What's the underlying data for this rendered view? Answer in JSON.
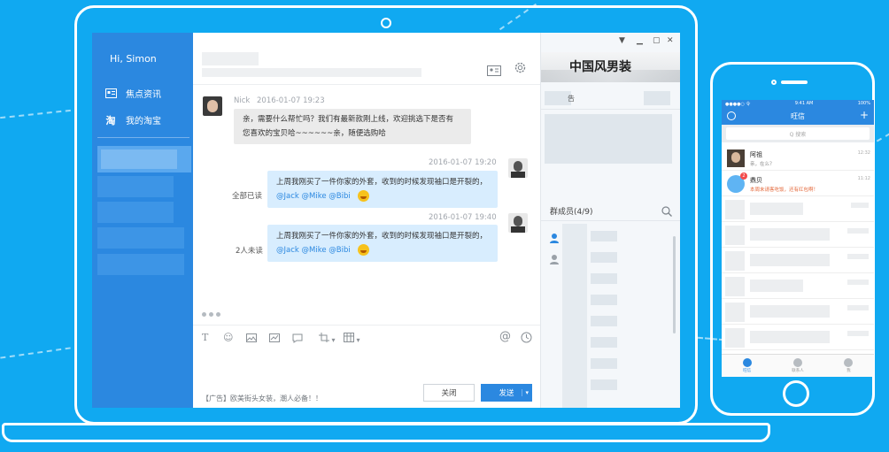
{
  "greeting": "Hi, Simon",
  "nav": [
    {
      "label": "焦点资讯",
      "icon": "news-icon"
    },
    {
      "label": "我的淘宝",
      "icon": "taobao-icon"
    }
  ],
  "messages": [
    {
      "sender": "Nick",
      "time": "2016-01-07  19:23",
      "line1": "亲，需要什么帮忙吗？我们有最新款刚上线，欢迎挑选下是否有",
      "line2": "您喜欢的宝贝哈~~~~~~亲，随便选购哈"
    },
    {
      "time": "2016-01-07  19:20",
      "line1": "上周我刚买了一件你家的外套，收到的时候发现袖口是开裂的，",
      "mentions": "@Jack @Mike @Bibi",
      "status": "全部已读"
    },
    {
      "time": "2016-01-07  19:40",
      "line1": "上周我刚买了一件你家的外套，收到的时候发现袖口是开裂的，",
      "mentions": "@Jack @Mike @Bibi",
      "status": "2人未读"
    }
  ],
  "ad_text": "【广告】欧美街头女装，潮人必备！！",
  "close_label": "关闭",
  "send_label": "发送",
  "shop_name": "中国风男装",
  "notice_label": "告",
  "members_label": "群成员(4/9)",
  "phone": {
    "carrier": "●●●●○ 令",
    "time": "9:41 AM",
    "battery": "100%",
    "title": "旺信",
    "search_placeholder": "Q 搜索",
    "chats": [
      {
        "name": "阿祖",
        "preview": "亲，在么？",
        "time": "12:32"
      },
      {
        "name": "鼎贝",
        "preview": "本周末请客吃饭，还有红包啊！",
        "time": "11:12",
        "badge": "2"
      }
    ],
    "tabs": [
      "旺信",
      "联系人",
      "我"
    ]
  }
}
